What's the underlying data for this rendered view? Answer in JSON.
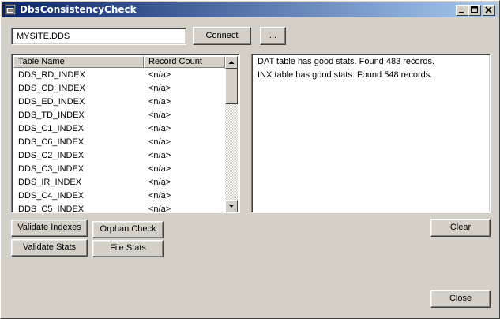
{
  "window": {
    "title": "DbsConsistencyCheck"
  },
  "connection": {
    "path_value": "MYSITE.DDS",
    "connect_label": "Connect",
    "browse_label": "..."
  },
  "table_list": {
    "columns": [
      "Table Name",
      "Record Count"
    ],
    "rows": [
      {
        "name": "DDS_RD_INDEX",
        "count": "<n/a>"
      },
      {
        "name": "DDS_CD_INDEX",
        "count": "<n/a>"
      },
      {
        "name": "DDS_ED_INDEX",
        "count": "<n/a>"
      },
      {
        "name": "DDS_TD_INDEX",
        "count": "<n/a>"
      },
      {
        "name": "DDS_C1_INDEX",
        "count": "<n/a>"
      },
      {
        "name": "DDS_C6_INDEX",
        "count": "<n/a>"
      },
      {
        "name": "DDS_C2_INDEX",
        "count": "<n/a>"
      },
      {
        "name": "DDS_C3_INDEX",
        "count": "<n/a>"
      },
      {
        "name": "DDS_IR_INDEX",
        "count": "<n/a>"
      },
      {
        "name": "DDS_C4_INDEX",
        "count": "<n/a>"
      },
      {
        "name": "DDS_C5_INDEX",
        "count": "<n/a>"
      }
    ]
  },
  "log": {
    "lines": [
      "DAT table has good stats. Found 483 records.",
      "INX table has good stats. Found 548 records."
    ]
  },
  "actions": {
    "validate_indexes": "Validate Indexes",
    "orphan_check": "Orphan Check",
    "validate_stats": "Validate Stats",
    "file_stats": "File Stats",
    "clear": "Clear",
    "close": "Close"
  }
}
